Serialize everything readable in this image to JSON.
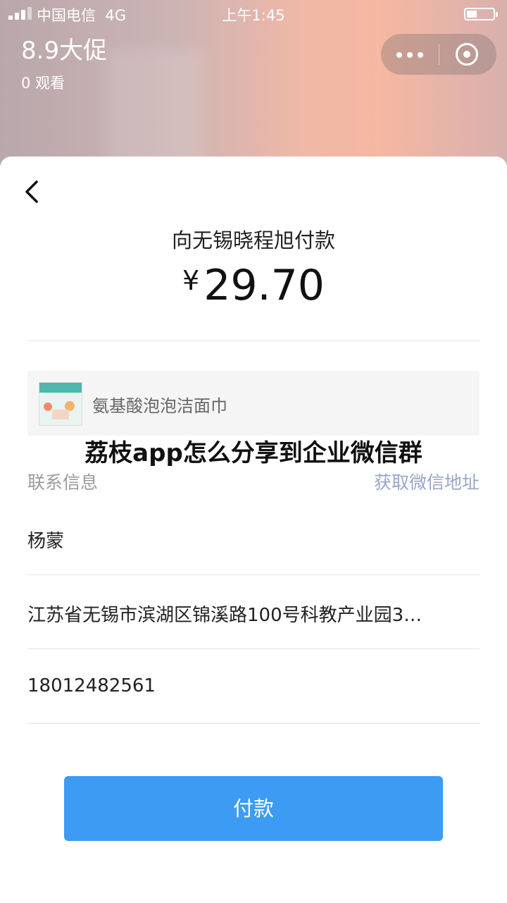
{
  "status_bar": {
    "carrier": "中国电信",
    "network": "4G",
    "time": "上午1:45"
  },
  "live": {
    "title": "8.9大促",
    "viewers": "0 观看"
  },
  "payment": {
    "pay_to": "向无锡晓程旭付款",
    "currency_symbol": "¥",
    "amount": "29.70",
    "product_name": "氨基酸泡泡洁面巾",
    "contact_label": "联系信息",
    "get_wechat_address": "获取微信地址",
    "name": "杨蒙",
    "address": "江苏省无锡市滨湖区锦溪路100号科教产业园3…",
    "phone": "18012482561",
    "pay_button": "付款"
  },
  "watermark": "荔枝app怎么分享到企业微信群",
  "colors": {
    "button": "#3d9bf3",
    "link": "#9aa6c8",
    "label": "#9b9b9b"
  }
}
